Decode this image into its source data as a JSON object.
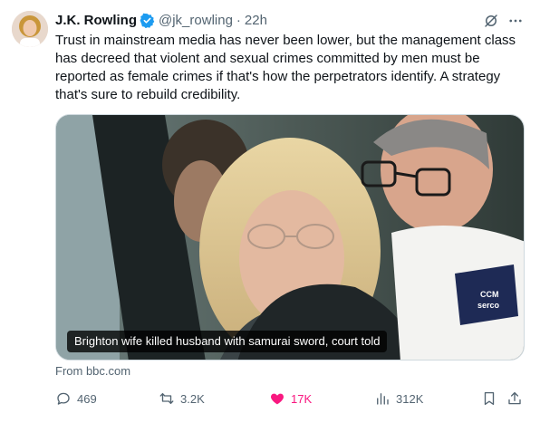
{
  "author": {
    "name": "J.K. Rowling",
    "handle": "@jk_rowling",
    "separator": "·",
    "time": "22h"
  },
  "tweet": {
    "text": "Trust in mainstream media has never been lower, but the management class has decreed that violent and sexual crimes committed by men must be reported as female crimes if that's how the perpetrators identify. A strategy that's sure to rebuild credibility."
  },
  "card": {
    "headline": "Brighton wife killed husband with samurai sword, court told",
    "source": "From bbc.com",
    "badge_line1": "CCM",
    "badge_line2": "serco"
  },
  "actions": {
    "replies": "469",
    "reposts": "3.2K",
    "likes": "17K",
    "views": "312K"
  },
  "colors": {
    "accent_blue": "#1d9bf0",
    "like_pink": "#f91880",
    "secondary_text": "#536471"
  },
  "icons": [
    "verified-badge-icon",
    "grok-icon",
    "more-icon",
    "reply-icon",
    "repost-icon",
    "like-heart-icon",
    "views-icon",
    "bookmark-icon",
    "share-icon"
  ]
}
